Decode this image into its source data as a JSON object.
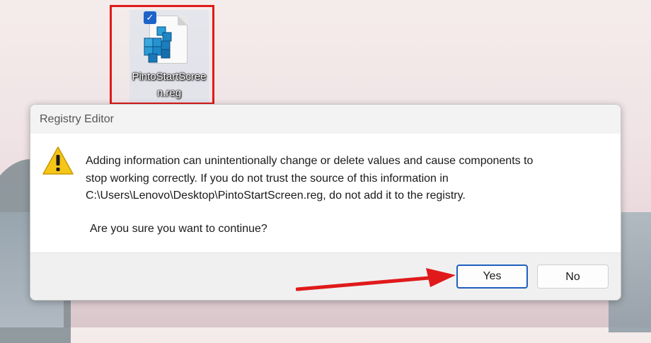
{
  "desktop": {
    "file_icon": {
      "name": "PintoStartScreen.reg",
      "icon": "registry-cubes-icon",
      "selected": true
    }
  },
  "dialog": {
    "title": "Registry Editor",
    "icon": "warning-icon",
    "message_lines": [
      "Adding information can unintentionally change or delete values and cause components to",
      "stop working correctly. If you do not trust the source of this information in",
      "C:\\Users\\Lenovo\\Desktop\\PintoStartScreen.reg, do not add it to the registry."
    ],
    "question": "Are you sure you want to continue?",
    "buttons": {
      "yes": "Yes",
      "no": "No"
    }
  },
  "annotations": {
    "highlight_color": "#e01a1a",
    "arrow_color": "#e01a1a"
  }
}
